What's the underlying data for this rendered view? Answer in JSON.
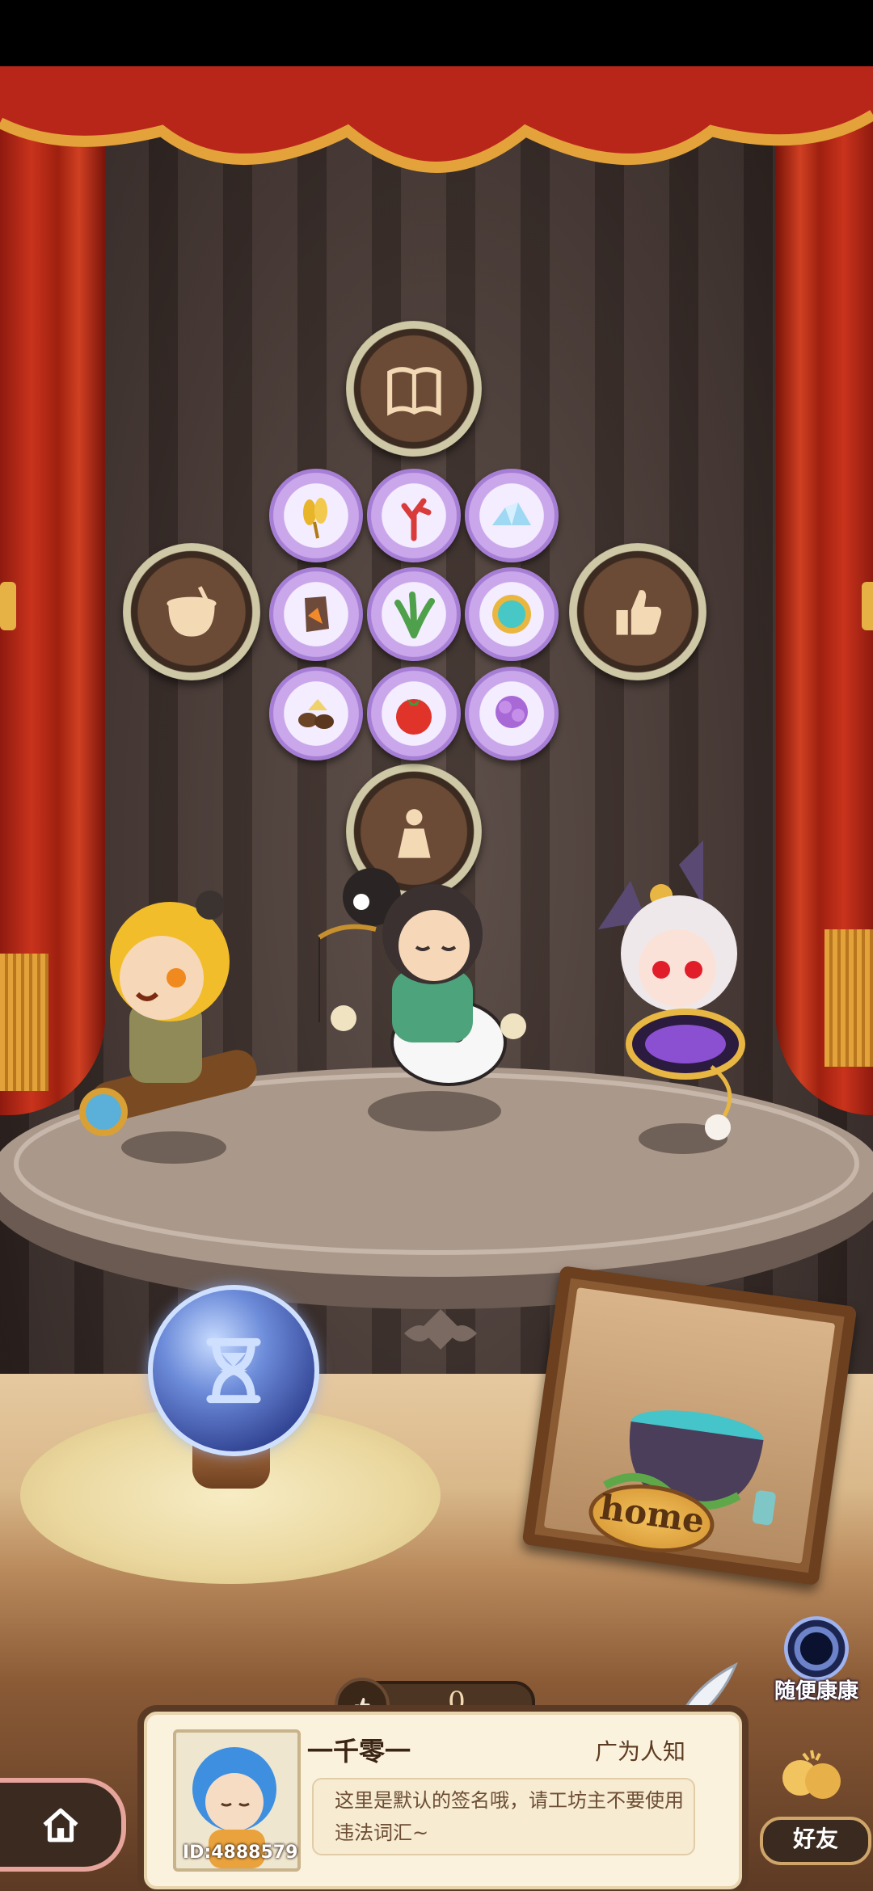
{
  "medals": [
    {
      "id": "book",
      "icon": "book-icon"
    },
    {
      "id": "cauldron",
      "icon": "cauldron-icon"
    },
    {
      "id": "like",
      "icon": "thumbs-up-icon"
    },
    {
      "id": "figure",
      "icon": "figure-icon"
    }
  ],
  "ingredients": [
    {
      "icon": "golden-wheat-icon"
    },
    {
      "icon": "coral-icon"
    },
    {
      "icon": "crystal-icon"
    },
    {
      "icon": "ore-icon"
    },
    {
      "icon": "herb-icon"
    },
    {
      "icon": "compass-icon"
    },
    {
      "icon": "nuts-icon"
    },
    {
      "icon": "tomato-icon"
    },
    {
      "icon": "purple-flower-icon"
    }
  ],
  "home_sign": {
    "label": "home"
  },
  "portal": {
    "label": "随便康康"
  },
  "likes": {
    "count": "0"
  },
  "profile": {
    "name": "一千零一",
    "fame": "广为人知",
    "id_label": "ID:4888579",
    "signature": "这里是默认的签名哦，请工坊主不要使用违法词汇~"
  },
  "friends": {
    "label": "好友"
  },
  "colors": {
    "curtain": "#c9331c",
    "medal_rim": "#cfc8a6",
    "item_bg": "#c9a7ea",
    "orb": "#6c8bd9"
  }
}
